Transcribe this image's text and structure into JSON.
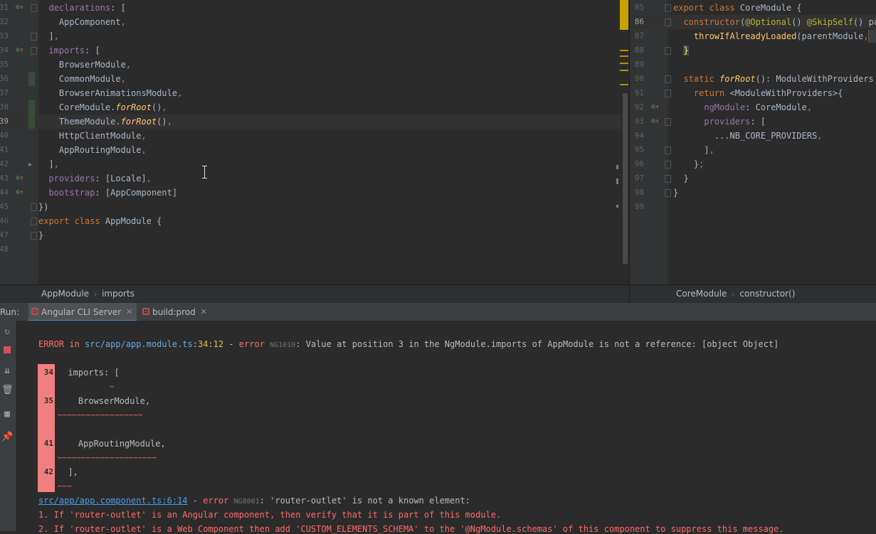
{
  "left_editor": {
    "lines": [
      {
        "n": "31",
        "text": "  declarations: ["
      },
      {
        "n": "32",
        "text": "    AppComponent,"
      },
      {
        "n": "33",
        "text": "  ],"
      },
      {
        "n": "34",
        "text": "  imports: ["
      },
      {
        "n": "35",
        "text": "    BrowserModule,"
      },
      {
        "n": "36",
        "text": "    CommonModule,"
      },
      {
        "n": "37",
        "text": "    BrowserAnimationsModule,"
      },
      {
        "n": "38",
        "text": "    CoreModule.forRoot(),"
      },
      {
        "n": "39",
        "text": "    ThemeModule.forRoot(),"
      },
      {
        "n": "40",
        "text": "    HttpClientModule,"
      },
      {
        "n": "41",
        "text": "    AppRoutingModule,"
      },
      {
        "n": "42",
        "text": "  ],"
      },
      {
        "n": "43",
        "text": "  providers: [Locale],"
      },
      {
        "n": "44",
        "text": "  bootstrap: [AppComponent]"
      },
      {
        "n": "45",
        "text": "})"
      },
      {
        "n": "46",
        "text": "export class AppModule {"
      },
      {
        "n": "47",
        "text": "}"
      },
      {
        "n": "48",
        "text": ""
      }
    ],
    "breadcrumb": [
      "AppModule",
      "imports"
    ]
  },
  "right_editor": {
    "lines": [
      {
        "n": "85",
        "text": "export class CoreModule {"
      },
      {
        "n": "86",
        "text": "  constructor(@Optional() @SkipSelf() par"
      },
      {
        "n": "87",
        "text": "    throwIfAlreadyLoaded(parentModule,"
      },
      {
        "n": "88",
        "text": "  }"
      },
      {
        "n": "89",
        "text": ""
      },
      {
        "n": "90",
        "text": "  static forRoot(): ModuleWithProviders {"
      },
      {
        "n": "91",
        "text": "    return <ModuleWithProviders>{"
      },
      {
        "n": "92",
        "text": "      ngModule: CoreModule,"
      },
      {
        "n": "93",
        "text": "      providers: ["
      },
      {
        "n": "94",
        "text": "        ...NB_CORE_PROVIDERS,"
      },
      {
        "n": "95",
        "text": "      ],"
      },
      {
        "n": "96",
        "text": "    };"
      },
      {
        "n": "97",
        "text": "  }"
      },
      {
        "n": "98",
        "text": "}"
      },
      {
        "n": "99",
        "text": ""
      }
    ],
    "breadcrumb": [
      "CoreModule",
      "constructor()"
    ]
  },
  "run_panel": {
    "label": "Run:",
    "tabs": [
      {
        "label": "Angular CLI Server"
      },
      {
        "label": "build:prod"
      }
    ]
  },
  "console": {
    "error1": {
      "prefix": "ERROR in ",
      "path": "src/app/app.module.ts",
      "colon": ":",
      "pos": "34:12",
      "dash": " - ",
      "error_word": "error",
      "code": "NG1010",
      "message": ": Value at position 3 in the NgModule.imports of AppModule is not a reference: [object Object]"
    },
    "snippet": [
      {
        "n": "34",
        "text": "  imports: [",
        "squig": "           ~"
      },
      {
        "n": "35",
        "text": "    BrowserModule,",
        "squig": "~~~~~~~~~~~~~~~~~~"
      },
      {
        "n": "...",
        "text": "",
        "squig": ""
      },
      {
        "n": "41",
        "text": "    AppRoutingModule,",
        "squig": "~~~~~~~~~~~~~~~~~~~~~"
      },
      {
        "n": "42",
        "text": "  ],",
        "squig": "~~~"
      }
    ],
    "error2": {
      "path": "src/app/app.component.ts:6:14",
      "dash": " - ",
      "error_word": "error",
      "code": "NG8001",
      "message": ": 'router-outlet' is not a known element:"
    },
    "hint1": "1. If 'router-outlet' is an Angular component, then verify that it is part of this module.",
    "hint2": "2. If 'router-outlet' is a Web Component then add 'CUSTOM_ELEMENTS_SCHEMA' to the '@NgModule.schemas' of this component to suppress this message."
  },
  "side_tools": [
    "rerun-icon",
    "stop-icon",
    "scroll-to-end-icon",
    "trash-icon",
    "layout-icon",
    "pin-icon"
  ]
}
